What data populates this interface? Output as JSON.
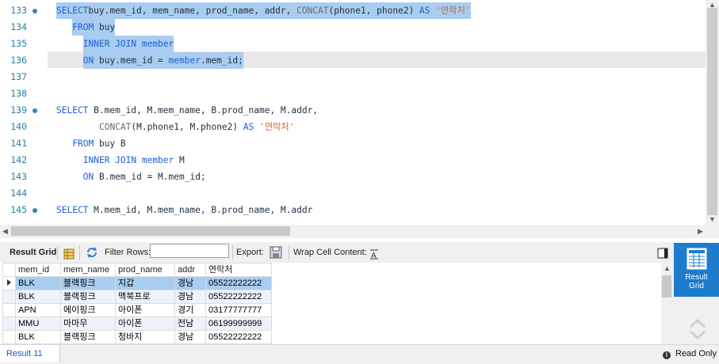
{
  "editor": {
    "lines": [
      {
        "num": "133",
        "dot": true,
        "sel": true,
        "indent": 0,
        "parts": [
          [
            "kw",
            "SELECT"
          ],
          [
            "",
            "buy.mem_id, mem_name, prod_name, addr, "
          ],
          [
            "fn",
            "CONCAT"
          ],
          [
            "",
            "(phone1, phone2) "
          ],
          [
            "kw",
            "AS"
          ],
          [
            "str",
            " '연락처'"
          ]
        ]
      },
      {
        "num": "134",
        "dot": false,
        "sel": true,
        "indent": 3,
        "parts": [
          [
            "kw",
            "FROM"
          ],
          [
            "",
            " buy"
          ]
        ]
      },
      {
        "num": "135",
        "dot": false,
        "sel": true,
        "indent": 5,
        "parts": [
          [
            "kw",
            "INNER JOIN"
          ],
          [
            "kw",
            " member"
          ]
        ]
      },
      {
        "num": "136",
        "dot": false,
        "sel": true,
        "indent": 5,
        "parts": [
          [
            "kw",
            "ON"
          ],
          [
            "",
            " buy.mem_id = "
          ],
          [
            "kw",
            "member"
          ],
          [
            "",
            ".mem_id;"
          ]
        ]
      },
      {
        "num": "137",
        "dot": false,
        "sel": false,
        "indent": 0,
        "parts": []
      },
      {
        "num": "138",
        "dot": false,
        "sel": false,
        "indent": 0,
        "parts": []
      },
      {
        "num": "139",
        "dot": true,
        "sel": false,
        "indent": 0,
        "parts": [
          [
            "kw",
            "SELECT"
          ],
          [
            "",
            " B.mem_id, M.mem_name, B.prod_name, M.addr,"
          ]
        ]
      },
      {
        "num": "140",
        "dot": false,
        "sel": false,
        "indent": 8,
        "parts": [
          [
            "fn",
            "CONCAT"
          ],
          [
            "",
            "(M.phone1, M.phone2) "
          ],
          [
            "kw",
            "AS"
          ],
          [
            "str",
            " '연락처'"
          ]
        ]
      },
      {
        "num": "141",
        "dot": false,
        "sel": false,
        "indent": 3,
        "parts": [
          [
            "kw",
            "FROM"
          ],
          [
            "",
            " buy B"
          ]
        ]
      },
      {
        "num": "142",
        "dot": false,
        "sel": false,
        "indent": 5,
        "parts": [
          [
            "kw",
            "INNER JOIN"
          ],
          [
            "kw",
            " member"
          ],
          [
            "",
            " M"
          ]
        ]
      },
      {
        "num": "143",
        "dot": false,
        "sel": false,
        "indent": 5,
        "parts": [
          [
            "kw",
            "ON"
          ],
          [
            "",
            " B.mem_id = M.mem_id;"
          ]
        ]
      },
      {
        "num": "144",
        "dot": false,
        "sel": false,
        "indent": 0,
        "parts": []
      },
      {
        "num": "145",
        "dot": true,
        "sel": false,
        "indent": 0,
        "parts": [
          [
            "kw",
            "SELECT"
          ],
          [
            "",
            " M.mem_id, M.mem_name, B.prod_name, M.addr"
          ]
        ]
      }
    ]
  },
  "toolbar": {
    "result_grid": "Result Grid",
    "filter_rows": "Filter Rows:",
    "filter_value": "",
    "export": "Export:",
    "wrap": "Wrap Cell Content:"
  },
  "grid": {
    "columns": [
      "mem_id",
      "mem_name",
      "prod_name",
      "addr",
      "연락처"
    ],
    "rows": [
      [
        "BLK",
        "블랙핑크",
        "지갑",
        "경남",
        "05522222222"
      ],
      [
        "BLK",
        "블랙핑크",
        "맥북프로",
        "경남",
        "05522222222"
      ],
      [
        "APN",
        "에이핑크",
        "아이폰",
        "경기",
        "03177777777"
      ],
      [
        "MMU",
        "마마무",
        "아이폰",
        "전남",
        "06199999999"
      ],
      [
        "BLK",
        "블랙핑크",
        "청바지",
        "경남",
        "05522222222"
      ]
    ]
  },
  "side": {
    "result_grid_line1": "Result",
    "result_grid_line2": "Grid"
  },
  "status": {
    "tab": "Result 11",
    "mode": "Read Only"
  },
  "colors": {
    "accent": "#1e7ccc",
    "selection": "#a9cdf0",
    "keyword": "#1e5fd4"
  }
}
